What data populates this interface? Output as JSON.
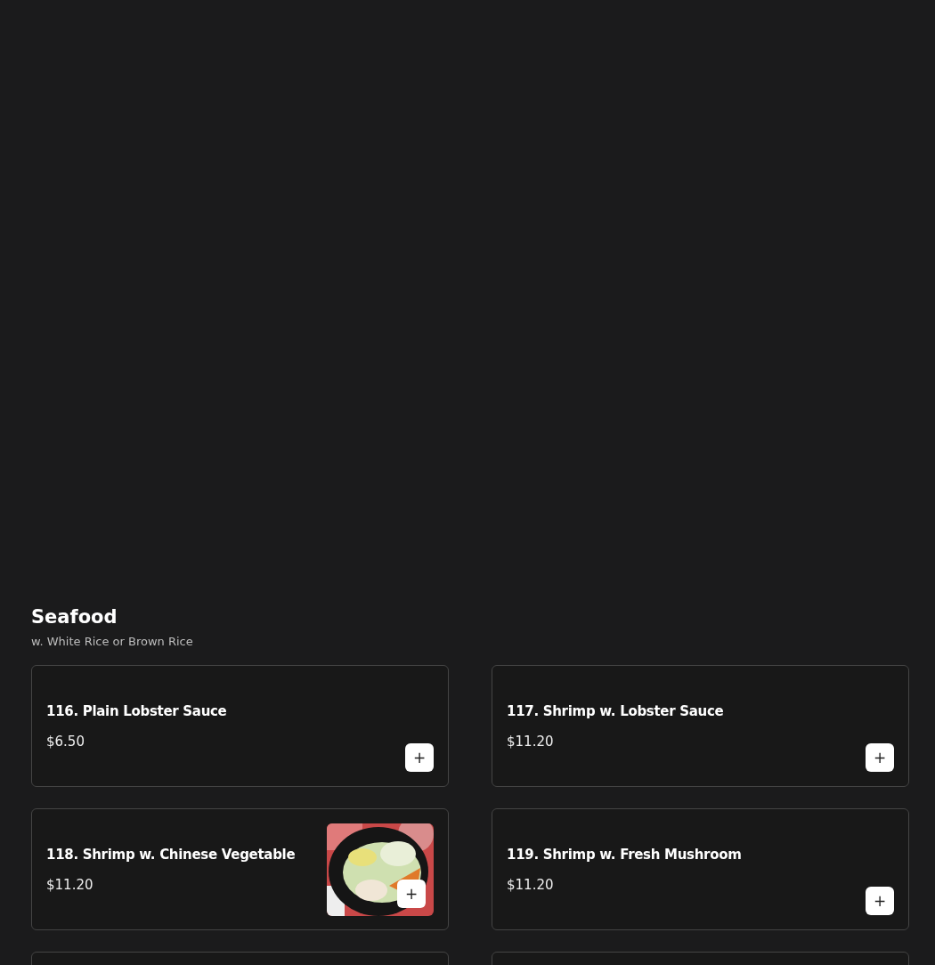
{
  "section": {
    "title": "Seafood",
    "subtitle": "w. White Rice or Brown Rice"
  },
  "items": [
    {
      "kind": "dish",
      "name": "116. Plain Lobster Sauce",
      "price": "$6.50",
      "add": "+"
    },
    {
      "kind": "dish",
      "name": "117. Shrimp w. Lobster Sauce",
      "price": "$11.20",
      "add": "+"
    },
    {
      "name": "118. Shrimp w. Chinese Vegetable",
      "price": "$11.20",
      "add": "+"
    },
    {
      "kind": "dish",
      "name": "119. Shrimp w. Fresh Mushroom",
      "price": "$11.20",
      "add": "+"
    },
    {
      "kind": "partial"
    },
    {
      "kind": "partial"
    }
  ]
}
